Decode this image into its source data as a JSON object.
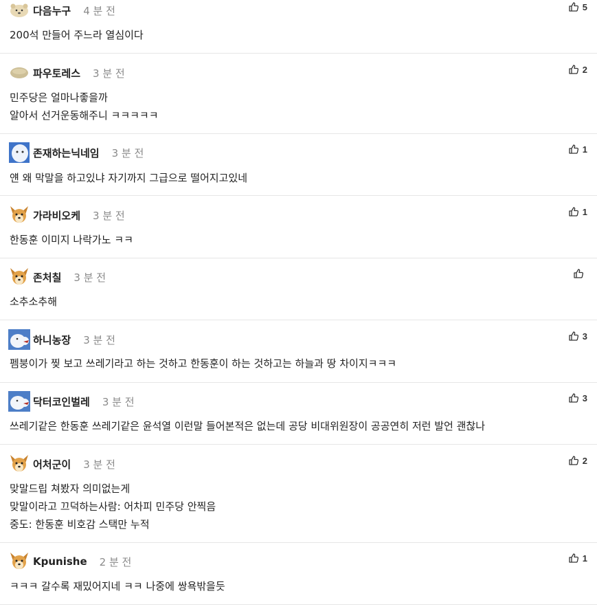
{
  "comments": [
    {
      "nickname": "다음누구",
      "time": "4 분 전",
      "lines": [
        "200석 만들어 주느라 열심이다"
      ],
      "likes": "5",
      "avatar": "bear-avatar-icon"
    },
    {
      "nickname": "파우토레스",
      "time": "3 분 전",
      "lines": [
        "민주당은 얼마나좋을까",
        "알아서 선거운동해주니 ㅋㅋㅋㅋㅋ"
      ],
      "likes": "2",
      "avatar": "bean-avatar-icon"
    },
    {
      "nickname": "존재하는닉네임",
      "time": "3 분 전",
      "lines": [
        "얜 왜 막말을 하고있냐 자기까지 그급으로 떨어지고있네"
      ],
      "likes": "1",
      "avatar": "snow-avatar-icon"
    },
    {
      "nickname": "가라비오케",
      "time": "3 분 전",
      "lines": [
        "한동훈 이미지 나락가노 ㅋㅋ"
      ],
      "likes": "1",
      "avatar": "dog-avatar-icon"
    },
    {
      "nickname": "존처칠",
      "time": "3 분 전",
      "lines": [
        "소추소추해"
      ],
      "likes": "",
      "avatar": "dog-avatar-icon"
    },
    {
      "nickname": "하니농장",
      "time": "3 분 전",
      "lines": [
        "펨붕이가 찢 보고 쓰레기라고 하는 것하고 한동훈이 하는 것하고는 하늘과 땅 차이지ㅋㅋㅋ"
      ],
      "likes": "3",
      "avatar": "snow-bird-avatar-icon"
    },
    {
      "nickname": "닥터코인벌레",
      "time": "3 분 전",
      "lines": [
        "쓰레기같은 한동훈 쓰레기같은 윤석열 이런말 들어본적은 없는데 공당 비대위원장이 공공연히 저런 발언 괜찮나"
      ],
      "likes": "3",
      "avatar": "snow-bird-avatar-icon"
    },
    {
      "nickname": "어처군이",
      "time": "3 분 전",
      "lines": [
        "맞말드립 쳐봤자 의미없는게",
        "맞말이라고 끄덕하는사람: 어차피 민주당 안찍음",
        "중도: 한동훈 비호감 스택만 누적"
      ],
      "likes": "2",
      "avatar": "dog-avatar-icon"
    },
    {
      "nickname": "Kpunishe",
      "time": "2 분 전",
      "lines": [
        "ㅋㅋㅋ 갈수록 재밌어지네 ㅋㅋ 나중에 쌍욕밖을듯"
      ],
      "likes": "1",
      "avatar": "dog-avatar-icon"
    }
  ],
  "colors": {
    "text": "#222222",
    "muted": "#8a8a8a",
    "divider": "#e6e6e6"
  },
  "icons": {
    "like": "thumbs-up-icon"
  }
}
